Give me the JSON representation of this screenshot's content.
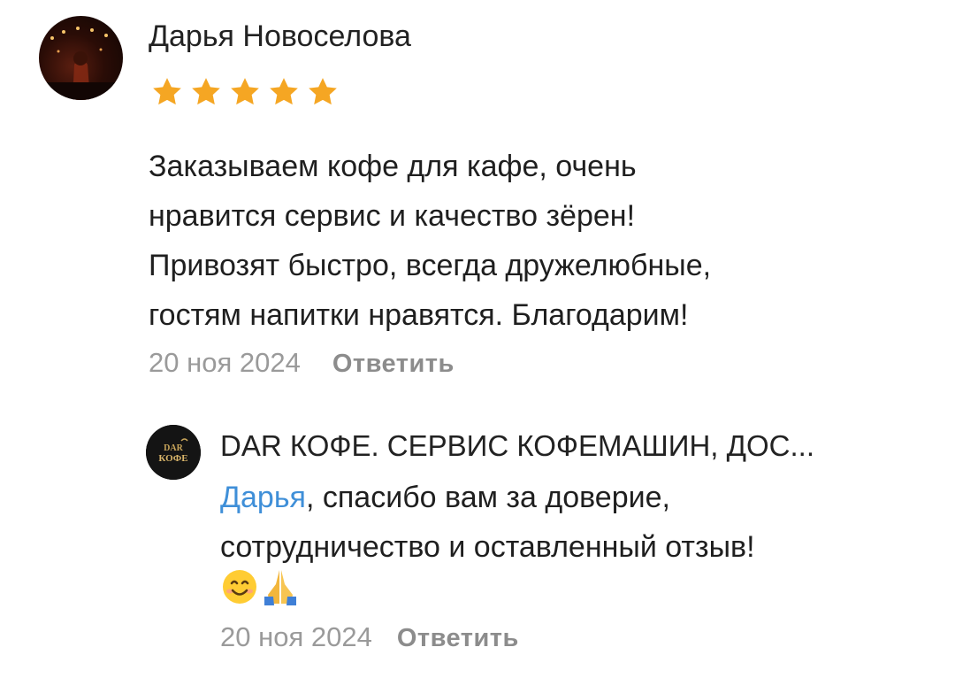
{
  "review": {
    "author": "Дарья Новоселова",
    "rating": 5,
    "rating_max": 5,
    "star_color": "#f5a623",
    "text": "Заказываем кофе для кафе, очень\nнравится сервис и качество зёрен!\nПривозят быстро, всегда дружелюбные,\nгостям напитки нравятся. Благодарим!",
    "date": "20 ноя 2024",
    "reply_label": "Ответить"
  },
  "response": {
    "author": "DAR КОФЕ. СЕРВИС КОФЕМАШИН, ДОС...",
    "avatar_text": "DAR КОФЕ",
    "mention": "Дарья",
    "text": ", спасибо вам за доверие,\nсотрудничество и оставленный отзыв!",
    "emojis": [
      "smiling-face-emoji",
      "folded-hands-emoji"
    ],
    "date": "20 ноя 2024",
    "reply_label": "Ответить",
    "mention_color": "#3f8fd8"
  }
}
